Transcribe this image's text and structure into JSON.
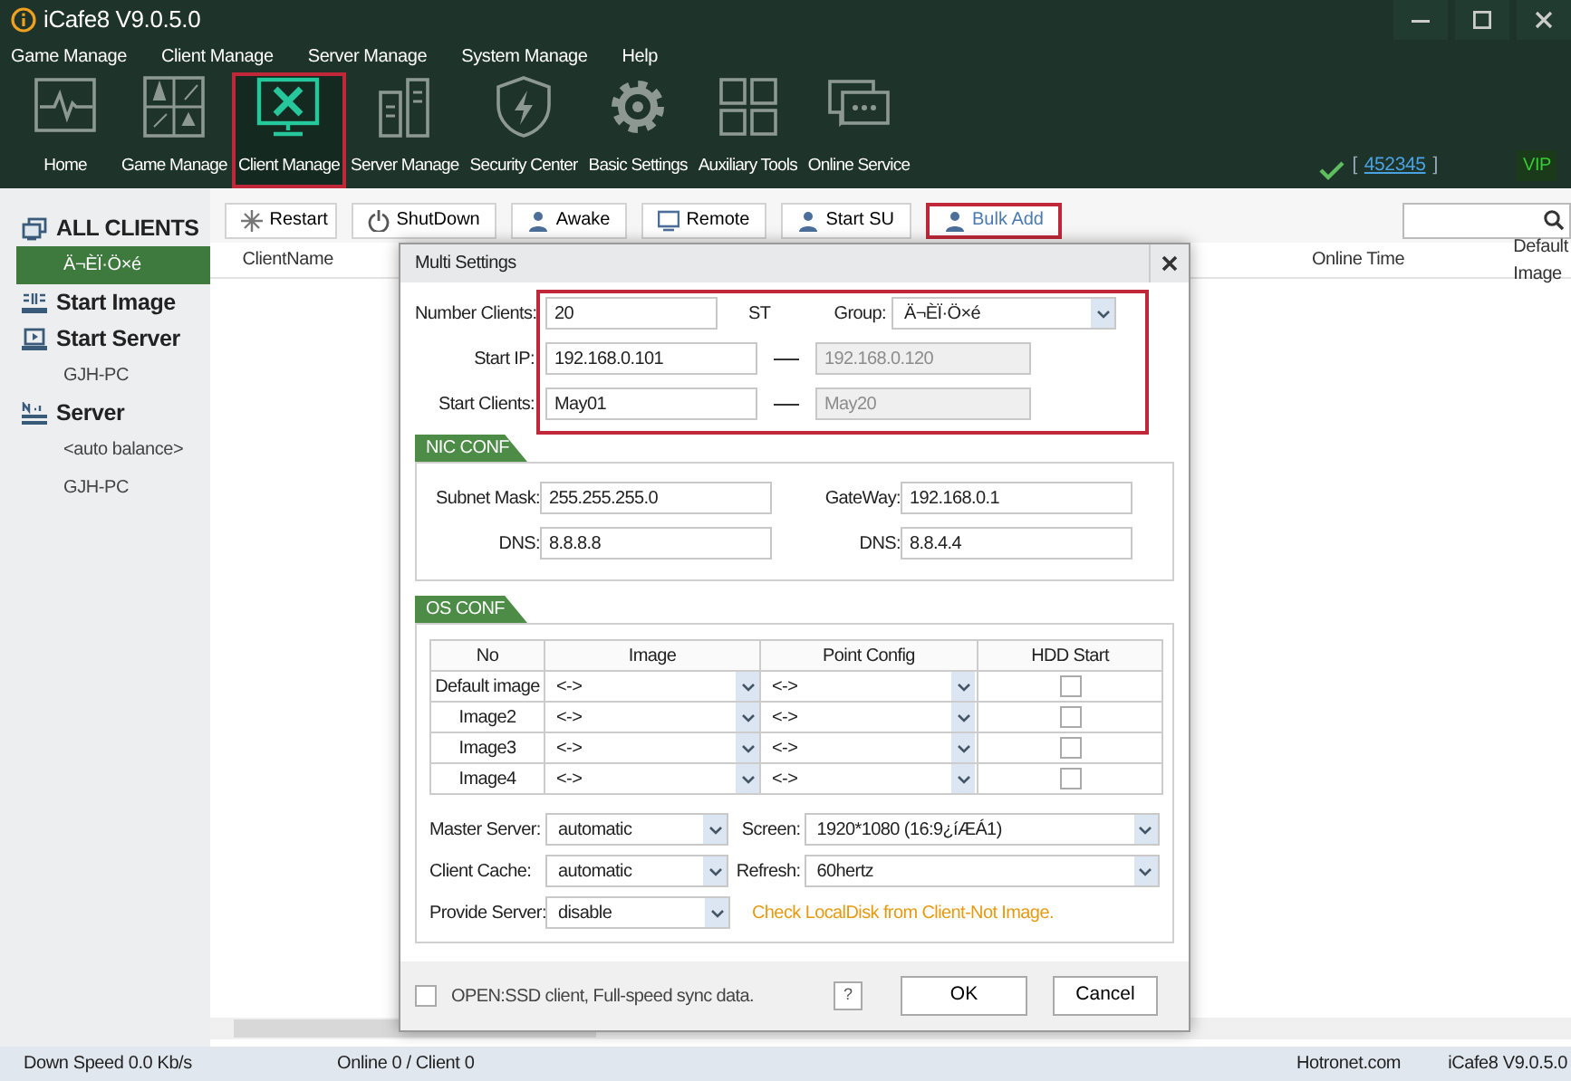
{
  "window": {
    "title": "iCafe8 V9.0.5.0"
  },
  "menu": [
    "Game Manage",
    "Client Manage",
    "Server Manage",
    "System Manage",
    "Help"
  ],
  "toolbar": [
    {
      "kind": "home",
      "label": "Home",
      "selected": false,
      "highlighted": false
    },
    {
      "kind": "game",
      "label": "Game Manage",
      "selected": false,
      "highlighted": false
    },
    {
      "kind": "client",
      "label": "Client Manage",
      "selected": true,
      "highlighted": true
    },
    {
      "kind": "server",
      "label": "Server Manage",
      "selected": false,
      "highlighted": false
    },
    {
      "kind": "shield",
      "label": "Security Center",
      "selected": false,
      "highlighted": false
    },
    {
      "kind": "gear",
      "label": "Basic Settings",
      "selected": false,
      "highlighted": false
    },
    {
      "kind": "grid",
      "label": "Auxiliary Tools",
      "selected": false,
      "highlighted": false
    },
    {
      "kind": "chat",
      "label": "Online Service",
      "selected": false,
      "highlighted": false
    }
  ],
  "account": {
    "open": "[",
    "id": "452345",
    "close": "]",
    "badge": "VIP"
  },
  "sidebar": [
    {
      "kind": "clients",
      "label": "ALL CLIENTS",
      "selected": false
    },
    {
      "kind": "item",
      "label": "Ä¬ÈÏ·Ö×é",
      "selected": true
    },
    {
      "kind": "image",
      "label": "Start Image",
      "selected": false
    },
    {
      "kind": "monitor",
      "label": "Start Server",
      "selected": false
    },
    {
      "kind": "item",
      "label": "GJH-PC",
      "selected": false
    },
    {
      "kind": "list",
      "label": "Server",
      "selected": false
    },
    {
      "kind": "item",
      "label": "<auto balance>",
      "selected": false
    },
    {
      "kind": "item",
      "label": "GJH-PC",
      "selected": false
    }
  ],
  "actions": [
    {
      "kind": "restart",
      "label": "Restart",
      "highlighted": false
    },
    {
      "kind": "power",
      "label": "ShutDown",
      "highlighted": false
    },
    {
      "kind": "person",
      "label": "Awake",
      "highlighted": false
    },
    {
      "kind": "screen",
      "label": "Remote",
      "highlighted": false
    },
    {
      "kind": "person",
      "label": "Start SU",
      "highlighted": false
    },
    {
      "kind": "person",
      "label": "Bulk Add",
      "highlighted": true
    }
  ],
  "table": {
    "columns": [
      "ClientName",
      "Online Time",
      "Default Image"
    ]
  },
  "dialog": {
    "title": "Multi Settings",
    "highlighted": true,
    "number_clients": {
      "label": "Number Clients:",
      "value": "20",
      "unit": "ST"
    },
    "group": {
      "label": "Group:",
      "value": "Ä¬ÈÏ·Ö×é"
    },
    "start_ip": {
      "label": "Start IP:",
      "value": "192.168.0.101",
      "end": "192.168.0.120"
    },
    "start_client": {
      "label": "Start Clients:",
      "value": "May01",
      "end": "May20"
    },
    "nic": {
      "title": "NIC CONF",
      "fields": [
        {
          "label": "Subnet Mask:",
          "value": "255.255.255.0"
        },
        {
          "label": "GateWay:",
          "value": "192.168.0.1"
        },
        {
          "label": "DNS:",
          "value": "8.8.8.8"
        },
        {
          "label": "DNS:",
          "value": "8.8.4.4"
        }
      ]
    },
    "os": {
      "title": "OS CONF",
      "columns": [
        "No",
        "Image",
        "Point Config",
        "HDD Start"
      ],
      "rows": [
        {
          "name": "Default image",
          "image": "<->",
          "point": "<->",
          "checked": false
        },
        {
          "name": "Image2",
          "image": "<->",
          "point": "<->",
          "checked": false
        },
        {
          "name": "Image3",
          "image": "<->",
          "point": "<->",
          "checked": false
        },
        {
          "name": "Image4",
          "image": "<->",
          "point": "<->",
          "checked": false
        }
      ],
      "settings": [
        {
          "label": "Master Server:",
          "value": "automatic"
        },
        {
          "label": "Screen:",
          "value": "1920*1080 (16:9¿íÆÁ1)"
        },
        {
          "label": "Client Cache:",
          "value": "automatic"
        },
        {
          "label": "Refresh:",
          "value": "60hertz"
        },
        {
          "label": "Provide Server:",
          "value": "disable"
        }
      ],
      "note": "Check LocalDisk from Client-Not Image."
    },
    "ssd": {
      "label": "OPEN:SSD client, Full-speed sync data.",
      "checked": false
    },
    "help": "?",
    "buttons": [
      "OK",
      "Cancel"
    ]
  },
  "status_bar": [
    "Down Speed 0.0 Kb/s",
    "Online 0 / Client 0",
    "Hotronet.com",
    "iCafe8 V9.0.5.0"
  ]
}
